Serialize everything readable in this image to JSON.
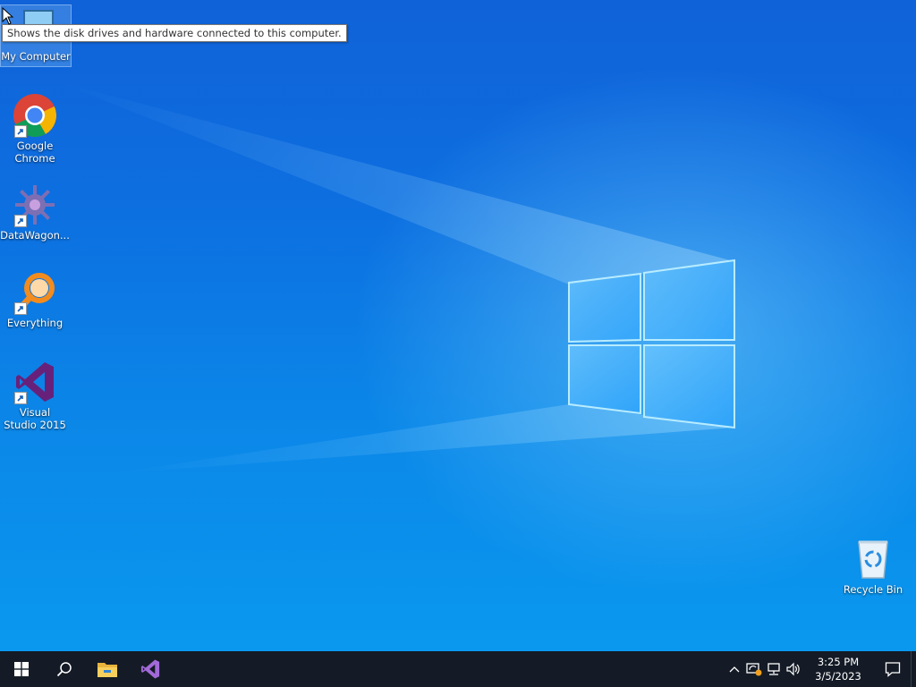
{
  "desktop": {
    "icons": [
      {
        "label": "My Computer",
        "icon": "computer-icon"
      },
      {
        "label": "Google Chrome",
        "icon": "chrome-icon"
      },
      {
        "label": "DataWagon...",
        "icon": "datawagon-icon"
      },
      {
        "label": "Everything",
        "icon": "everything-search-icon"
      },
      {
        "label": "Visual Studio 2015",
        "icon": "visual-studio-icon"
      },
      {
        "label": "Recycle Bin",
        "icon": "recycle-bin-icon"
      }
    ],
    "tooltip": "Shows the disk drives and hardware connected to this computer."
  },
  "taskbar": {
    "pinned": [
      {
        "name": "start",
        "icon": "windows-logo-icon"
      },
      {
        "name": "search",
        "icon": "search-icon"
      },
      {
        "name": "file-explorer",
        "icon": "folder-icon"
      },
      {
        "name": "visual-studio",
        "icon": "visual-studio-icon"
      }
    ],
    "tray": {
      "icons": [
        "chevron-up-icon",
        "update-alert-icon",
        "network-icon",
        "volume-icon"
      ],
      "time": "3:25 PM",
      "date": "3/5/2023",
      "notification_icon": "action-center-icon"
    }
  },
  "colors": {
    "taskbar": "#141b26",
    "visual_studio": "#68217a",
    "chrome_red": "#db4437",
    "everything_orange": "#f28c1e"
  }
}
